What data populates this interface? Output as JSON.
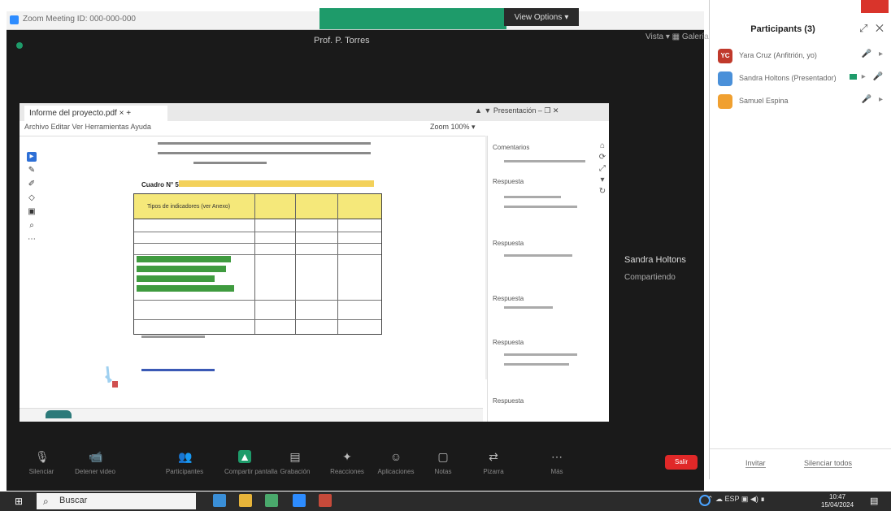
{
  "window": {
    "title": "Zoom Meeting ID: 000-000-000",
    "speaker_name": "Prof. P. Torres",
    "view_options": "View Options",
    "view_options_chevron": "▾",
    "top_right": "Vista ▾  ▦ Galería",
    "side_speaker": "Sandra Holtons",
    "side_speaker_sub": "Compartiendo"
  },
  "browser": {
    "tab_title": "Informe del proyecto.pdf  ×  +",
    "menu": "Archivo   Editar   Ver   Herramientas   Ayuda",
    "top_right": "▲ ▼  Presentación  –  ❐  ✕",
    "zoom": "Zoom 100%  ▾",
    "tools": [
      "▸",
      "✎",
      "✐",
      "◇",
      "▣",
      "⌕",
      "⋯"
    ],
    "doc_cuadro_label": "Cuadro N° 53",
    "table_header_label": "Tipos de indicadores (ver Anexo)"
  },
  "right_panel": {
    "items": [
      "Comentarios",
      "Respuesta",
      "Respuesta",
      "Respuesta",
      "Respuesta",
      "Respuesta"
    ],
    "icons": [
      "⌂",
      "⟳",
      "⤢",
      "▾",
      "↻"
    ]
  },
  "controls": [
    {
      "icon": "🎙",
      "label": "Silenciar"
    },
    {
      "icon": "📹",
      "label": "Detener video"
    },
    {
      "icon": "👥",
      "label": "Participantes"
    },
    {
      "icon": "▲",
      "label": "Compartir pantalla"
    },
    {
      "icon": "▤",
      "label": "Grabación"
    },
    {
      "icon": "✦",
      "label": "Reacciones"
    },
    {
      "icon": "☺",
      "label": "Aplicaciones"
    },
    {
      "icon": "▢",
      "label": "Notas"
    },
    {
      "icon": "⇄",
      "label": "Pizarra"
    },
    {
      "icon": "⋯",
      "label": "Más"
    }
  ],
  "end_label": "Salir",
  "participants": {
    "title": "Participants (3)",
    "head_icons": "⤢ ✕",
    "rows": [
      {
        "initials": "YC",
        "color": "#c0392b",
        "name": "Yara Cruz (Anfitrión, yo)",
        "icons": "🎤 ▸"
      },
      {
        "initials": "",
        "color": "#4a90d9",
        "name": "Sandra Holtons (Presentador)",
        "icons": "▸ 🎤"
      },
      {
        "initials": "",
        "color": "#f0a030",
        "name": "Samuel Espina",
        "icons": "🎤 ▸"
      }
    ],
    "invite": "Invitar",
    "mute_all": "Silenciar todos"
  },
  "taskbar": {
    "start_icon": "⊞",
    "search_icon": "⌕",
    "search_text": "Buscar",
    "tray": "⌃  ☁  ESP  ▣  ◀)  ∎",
    "time": "10:47",
    "date": "15/04/2024",
    "notif_icon": "▤"
  }
}
